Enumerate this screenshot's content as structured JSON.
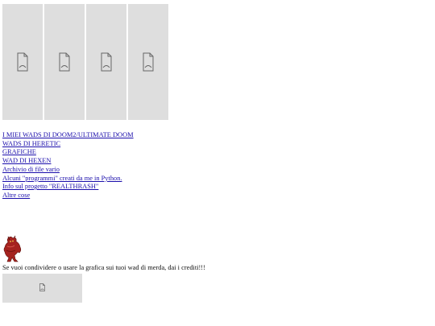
{
  "banner": {
    "images": [
      {
        "icon": "broken-image-icon"
      },
      {
        "icon": "broken-image-icon"
      },
      {
        "icon": "broken-image-icon"
      },
      {
        "icon": "broken-image-icon"
      }
    ]
  },
  "nav": {
    "links": [
      {
        "label": "I MIEI WADS DI DOOM2/ULTIMATE DOOM"
      },
      {
        "label": "WADS DI HERETIC"
      },
      {
        "label": "GRAFICHE"
      },
      {
        "label": "WAD DI HEXEN"
      },
      {
        "label": "Archivio di file vario"
      },
      {
        "label": "Alcuni \"programmi\" creati da me in Python."
      },
      {
        "label": "Info sul progetto \"REALTHRASH\""
      },
      {
        "label": "Altre cose"
      }
    ],
    "link_color": "#1a0dab"
  },
  "demon_sprite": {
    "icon": "demon-sprite-icon"
  },
  "credit": {
    "text": "Se vuoi condividere o usare la grafica sui tuoi wad di merda, dai i crediti!!!"
  },
  "footer_image": {
    "icon": "broken-image-icon"
  }
}
